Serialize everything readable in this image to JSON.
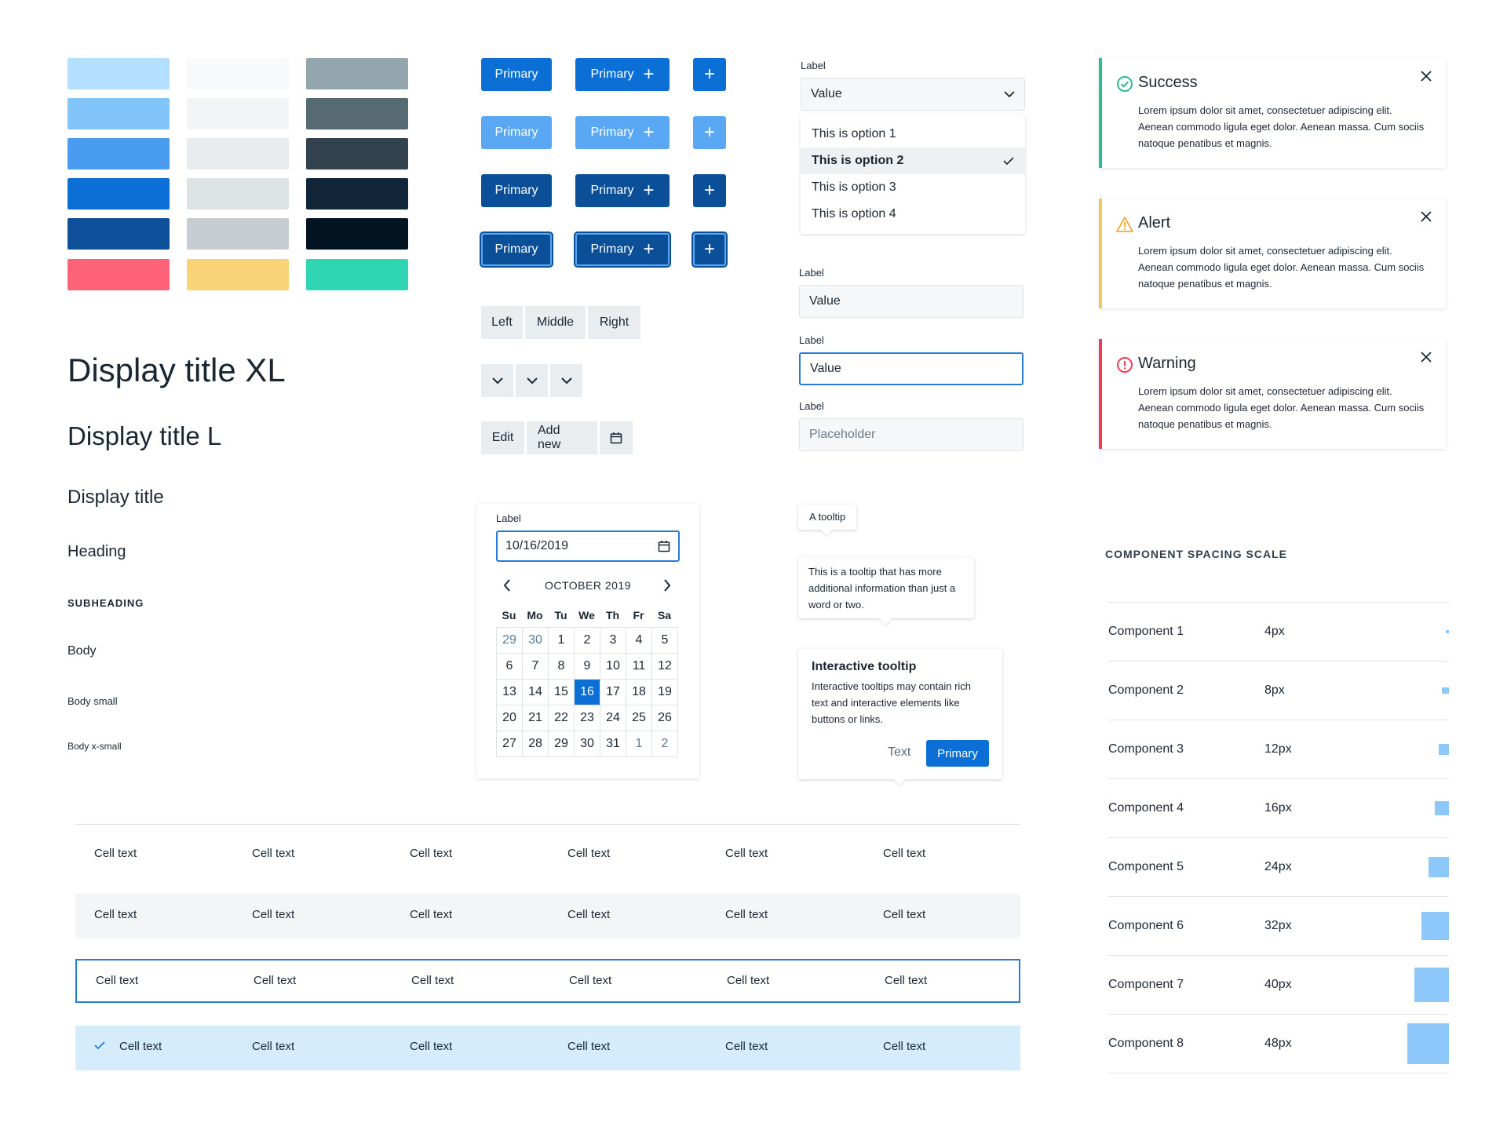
{
  "colors": {
    "swatches_col1": [
      "#b3e0fd",
      "#82c5fa",
      "#4a9cf0",
      "#0b6fd6",
      "#0d4f98",
      "#fe6279"
    ],
    "swatches_col2": [
      "#f8f9fa",
      "#f2f4f5",
      "#e9ecee",
      "#dde2e5",
      "#c5ccd2",
      "#f9d375"
    ],
    "swatches_col3": [
      "#93a6ad",
      "#566a74",
      "#32434f",
      "#122639",
      "#021422",
      "#30d5b4"
    ],
    "primary": "#0b6fd6",
    "success": "#2bbf8f",
    "alert": "#f6c65c",
    "warning": "#ee3c57"
  },
  "buttons": {
    "label": "Primary",
    "plus_icon": "plus-icon"
  },
  "typography": {
    "display_xl": "Display title XL",
    "display_l": "Display title L",
    "display": "Display title",
    "heading": "Heading",
    "subheading": "SUBHEADING",
    "body": "Body",
    "body_small": "Body small",
    "body_xsmall": "Body x-small"
  },
  "segmented": {
    "left": "Left",
    "middle": "Middle",
    "right": "Right"
  },
  "toolbar": {
    "edit": "Edit",
    "add_new": "Add new"
  },
  "dropdown": {
    "label": "Label",
    "value": "Value",
    "options": [
      "This is option 1",
      "This is option 2",
      "This is option 3",
      "This is option 4"
    ],
    "selected_index": 1
  },
  "fields": {
    "default": {
      "label": "Label",
      "value": "Value"
    },
    "focused": {
      "label": "Label",
      "value": "Value"
    },
    "placeholder": {
      "label": "Label",
      "placeholder": "Placeholder"
    }
  },
  "datepicker": {
    "label": "Label",
    "value": "10/16/2019",
    "month": "OCTOBER 2019",
    "weekdays": [
      "Su",
      "Mo",
      "Tu",
      "We",
      "Th",
      "Fr",
      "Sa"
    ],
    "days": [
      "29",
      "30",
      "1",
      "2",
      "3",
      "4",
      "5",
      "6",
      "7",
      "8",
      "9",
      "10",
      "11",
      "12",
      "13",
      "14",
      "15",
      "16",
      "17",
      "18",
      "19",
      "20",
      "21",
      "22",
      "23",
      "24",
      "25",
      "26",
      "27",
      "28",
      "29",
      "30",
      "31",
      "1",
      "2"
    ]
  },
  "tooltips": {
    "simple": "A tooltip",
    "long": "This is a tooltip that has more additional information than just a word or two.",
    "interactive": {
      "title": "Interactive tooltip",
      "body": "Interactive tooltips may contain rich text and interactive elements like buttons or links.",
      "text_button": "Text",
      "primary_button": "Primary"
    }
  },
  "alerts": [
    {
      "title": "Success",
      "body": "Lorem ipsum dolor sit amet, consectetuer adipiscing elit. Aenean commodo ligula eget dolor. Aenean massa. Cum sociis natoque penatibus et magnis."
    },
    {
      "title": "Alert",
      "body": "Lorem ipsum dolor sit amet, consectetuer adipiscing elit. Aenean commodo ligula eget dolor. Aenean massa. Cum sociis natoque penatibus et magnis."
    },
    {
      "title": "Warning",
      "body": "Lorem ipsum dolor sit amet, consectetuer adipiscing elit. Aenean commodo ligula eget dolor. Aenean massa. Cum sociis natoque penatibus et magnis."
    }
  ],
  "table": {
    "cell": "Cell text",
    "rows": [
      [
        "Cell text",
        "Cell text",
        "Cell text",
        "Cell text",
        "Cell text",
        "Cell text"
      ],
      [
        "Cell text",
        "Cell text",
        "Cell text",
        "Cell text",
        "Cell text",
        "Cell text"
      ],
      [
        "Cell text",
        "Cell text",
        "Cell text",
        "Cell text",
        "Cell text",
        "Cell text"
      ],
      [
        "Cell text",
        "Cell text",
        "Cell text",
        "Cell text",
        "Cell text",
        "Cell text"
      ]
    ]
  },
  "spacing": {
    "title": "COMPONENT SPACING SCALE",
    "items": [
      {
        "name": "Component 1",
        "value": "4px",
        "size": 4
      },
      {
        "name": "Component 2",
        "value": "8px",
        "size": 8
      },
      {
        "name": "Component 3",
        "value": "12px",
        "size": 12
      },
      {
        "name": "Component 4",
        "value": "16px",
        "size": 16
      },
      {
        "name": "Component 5",
        "value": "24px",
        "size": 24
      },
      {
        "name": "Component 6",
        "value": "32px",
        "size": 32
      },
      {
        "name": "Component 7",
        "value": "40px",
        "size": 40
      },
      {
        "name": "Component 8",
        "value": "48px",
        "size": 48
      }
    ]
  }
}
